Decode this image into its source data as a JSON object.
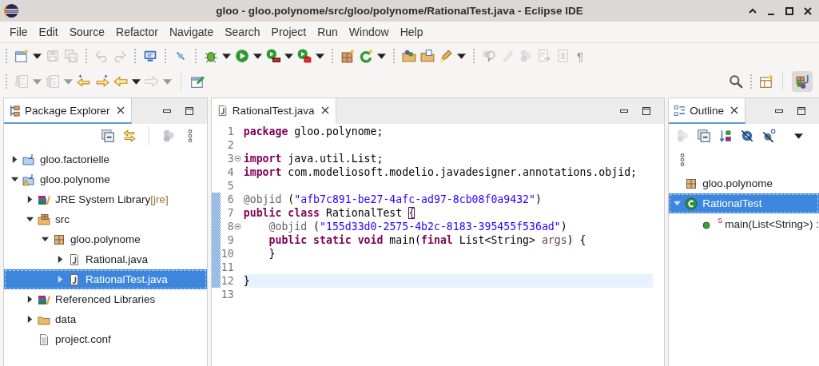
{
  "window": {
    "title": "gloo - gloo.polynome/src/gloo/polynome/RationalTest.java - Eclipse IDE"
  },
  "menu": [
    "File",
    "Edit",
    "Source",
    "Refactor",
    "Navigate",
    "Search",
    "Project",
    "Run",
    "Window",
    "Help"
  ],
  "toolbar": {
    "glyph": "¶"
  },
  "package_explorer": {
    "tab": {
      "label": "Package Explorer",
      "selected": true
    },
    "tree": [
      {
        "label": "gloo.factorielle",
        "kind": "project",
        "expanded": false,
        "selected": false
      },
      {
        "label": "gloo.polynome",
        "kind": "project-warning",
        "expanded": true,
        "selected": false,
        "children": [
          {
            "label": "JRE System Library",
            "decoration": "[jre]",
            "kind": "library",
            "expanded": false,
            "selected": false
          },
          {
            "label": "src",
            "kind": "source-folder",
            "expanded": true,
            "selected": false,
            "children": [
              {
                "label": "gloo.polynome",
                "kind": "package",
                "expanded": true,
                "selected": false,
                "children": [
                  {
                    "label": "Rational.java",
                    "kind": "java",
                    "expanded": false,
                    "selected": false
                  },
                  {
                    "label": "RationalTest.java",
                    "kind": "java",
                    "expanded": false,
                    "selected": true
                  }
                ]
              }
            ]
          },
          {
            "label": "Referenced Libraries",
            "kind": "library",
            "expanded": false,
            "selected": false
          },
          {
            "label": "data",
            "kind": "folder",
            "expanded": false,
            "selected": false
          },
          {
            "label": "project.conf",
            "kind": "file",
            "selected": false
          }
        ]
      }
    ]
  },
  "editor": {
    "tab": {
      "label": "RationalTest.java",
      "selected": true
    },
    "lines": [
      {
        "number": "1",
        "fold": false,
        "changed": false,
        "current": false,
        "tokens": [
          {
            "keyword": "package"
          },
          {
            "text": " gloo.polynome;"
          }
        ]
      },
      {
        "number": "2",
        "fold": false,
        "changed": false,
        "current": false
      },
      {
        "number": "3",
        "fold": true,
        "changed": false,
        "current": false,
        "tokens": [
          {
            "keyword": "import"
          },
          {
            "text": " java.util.List;"
          }
        ]
      },
      {
        "number": "4",
        "fold": false,
        "changed": false,
        "current": false,
        "tokens": [
          {
            "keyword": "import"
          },
          {
            "text": " com.modeliosoft.modelio.javadesigner.annotations.objid;"
          }
        ]
      },
      {
        "number": "5",
        "fold": false,
        "changed": false,
        "current": false
      },
      {
        "number": "6",
        "fold": false,
        "changed": true,
        "current": false,
        "tokens": [
          {
            "annotation": "@objid"
          },
          {
            "text": " ("
          },
          {
            "string": "\"afb7c891-be27-4afc-ad97-8cb08f0a9432\""
          },
          {
            "text": ")"
          }
        ]
      },
      {
        "number": "7",
        "fold": false,
        "changed": true,
        "current": false,
        "tokens": [
          {
            "keyword": "public "
          },
          {
            "keyword": "class"
          },
          {
            "text": " RationalTest "
          },
          {
            "bracket": "{"
          }
        ]
      },
      {
        "number": "8",
        "fold": true,
        "changed": true,
        "current": false,
        "tokens": [
          {
            "annotation": "    @objid"
          },
          {
            "text": " ("
          },
          {
            "string": "\"155d33d0-2575-4b2c-8183-395455f536ad\""
          },
          {
            "text": ")"
          }
        ]
      },
      {
        "number": "9",
        "fold": false,
        "changed": true,
        "current": false,
        "tokens": [
          {
            "keyword": "    public static void"
          },
          {
            "text": " main("
          },
          {
            "keyword": "final"
          },
          {
            "text": " List<String> "
          },
          {
            "parameter": "args"
          },
          {
            "text": ") {"
          }
        ]
      },
      {
        "number": "10",
        "fold": false,
        "changed": true,
        "current": false,
        "tokens": [
          {
            "text": "    }"
          }
        ]
      },
      {
        "number": "11",
        "fold": false,
        "changed": true,
        "current": false
      },
      {
        "number": "12",
        "fold": false,
        "changed": true,
        "current": true,
        "tokens": [
          {
            "text": "}"
          }
        ]
      },
      {
        "number": "13",
        "fold": false,
        "changed": false,
        "current": false
      }
    ]
  },
  "outline": {
    "tab": {
      "label": "Outline",
      "selected": true
    },
    "tree": [
      {
        "label": "gloo.polynome",
        "kind": "package",
        "selected": false
      },
      {
        "label": "RationalTest",
        "kind": "class",
        "expanded": true,
        "selected": true,
        "children": [
          {
            "label": "main(List<String>) :",
            "modifier": "S",
            "kind": "method",
            "selected": false
          }
        ]
      }
    ]
  }
}
